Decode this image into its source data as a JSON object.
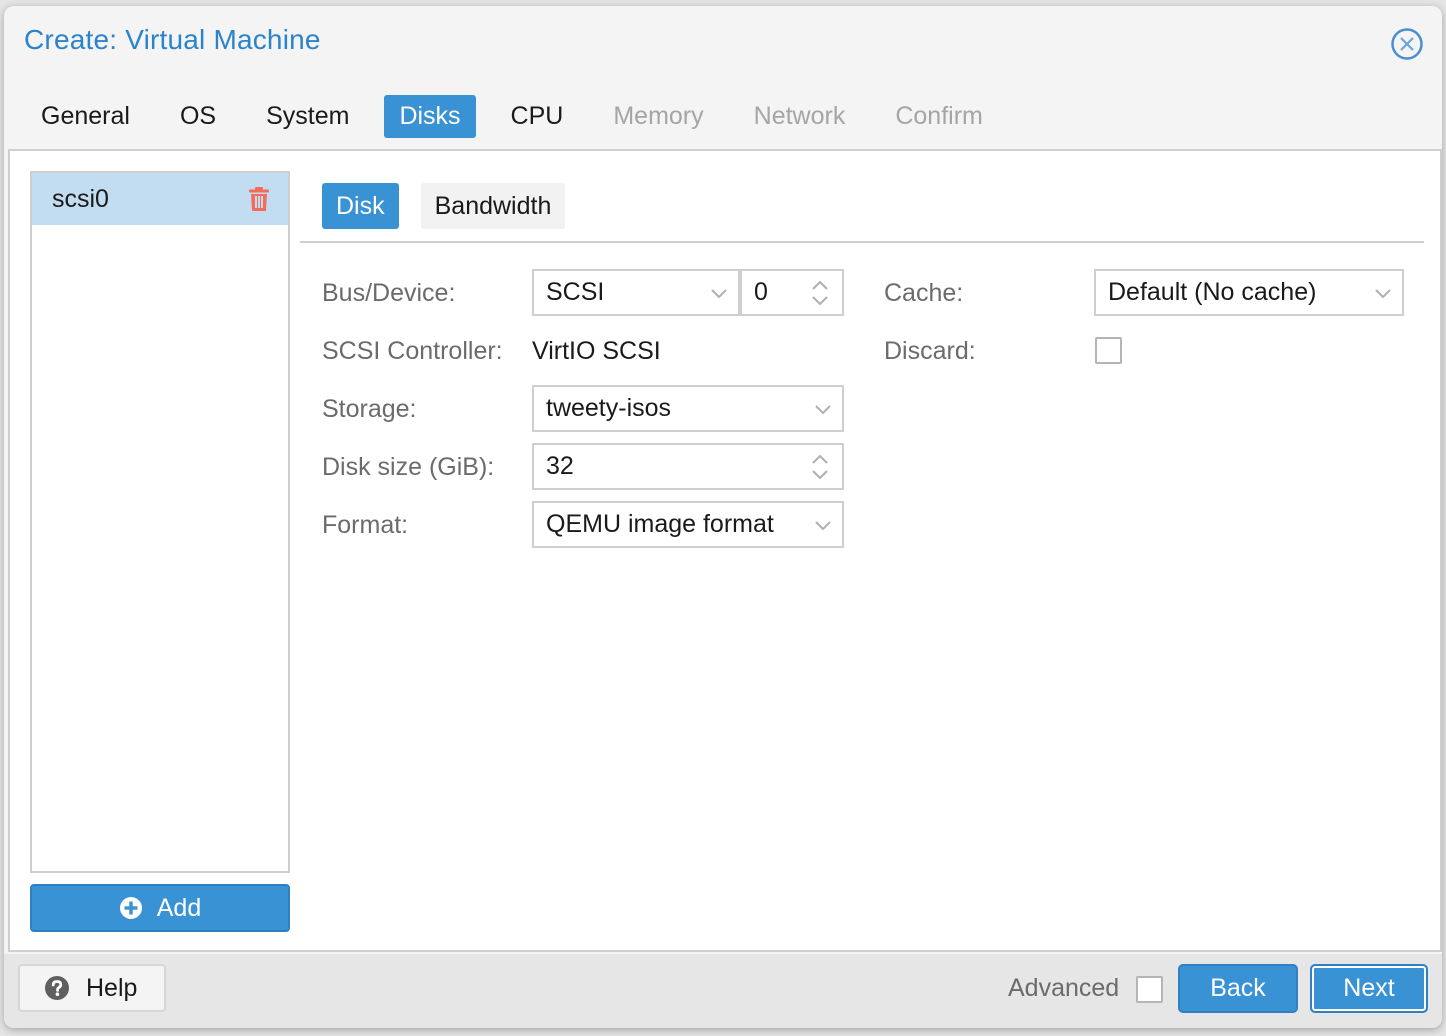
{
  "window": {
    "title": "Create: Virtual Machine",
    "close_icon": "circle-x-icon"
  },
  "tabs": [
    {
      "label": "General",
      "state": "normal"
    },
    {
      "label": "OS",
      "state": "normal"
    },
    {
      "label": "System",
      "state": "normal"
    },
    {
      "label": "Disks",
      "state": "active"
    },
    {
      "label": "CPU",
      "state": "normal"
    },
    {
      "label": "Memory",
      "state": "disabled"
    },
    {
      "label": "Network",
      "state": "disabled"
    },
    {
      "label": "Confirm",
      "state": "disabled"
    }
  ],
  "disk_list": {
    "items": [
      {
        "label": "scsi0",
        "selected": true,
        "remove_icon": "trash-icon"
      }
    ],
    "add_label": "Add",
    "add_icon": "plus-circle-icon"
  },
  "subtabs": [
    {
      "label": "Disk",
      "active": true
    },
    {
      "label": "Bandwidth",
      "active": false
    }
  ],
  "form": {
    "bus_device": {
      "label": "Bus/Device:",
      "bus": "SCSI",
      "device": "0"
    },
    "scsi_controller": {
      "label": "SCSI Controller:",
      "value": "VirtIO SCSI"
    },
    "storage": {
      "label": "Storage:",
      "value": "tweety-isos"
    },
    "disk_size": {
      "label": "Disk size (GiB):",
      "value": "32"
    },
    "format": {
      "label": "Format:",
      "value": "QEMU image format"
    },
    "cache": {
      "label": "Cache:",
      "value": "Default (No cache)"
    },
    "discard": {
      "label": "Discard:",
      "checked": false
    }
  },
  "footer": {
    "help_label": "Help",
    "help_icon": "question-circle-icon",
    "advanced_label": "Advanced",
    "advanced_checked": false,
    "back_label": "Back",
    "next_label": "Next"
  },
  "colors": {
    "accent": "#3892d4",
    "title": "#2b83cc",
    "selected_row": "#c2ddf1",
    "danger": "#f26b5b",
    "disabled_text": "#a5a5a5"
  }
}
